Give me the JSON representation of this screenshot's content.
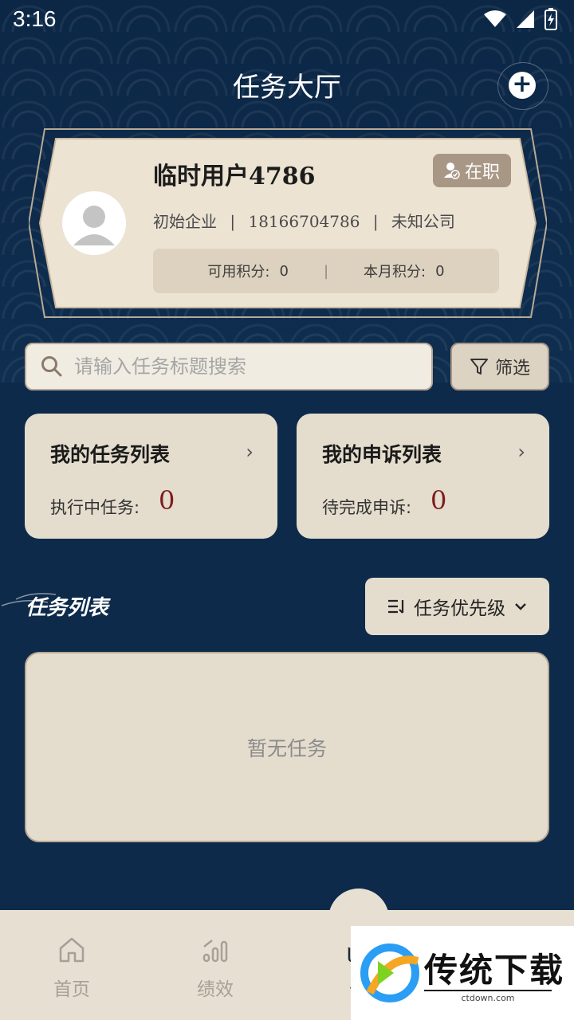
{
  "status_bar": {
    "time": "3:16"
  },
  "header": {
    "title": "任务大厅"
  },
  "profile": {
    "name": "临时用户4786",
    "status_badge": "在职",
    "company_type": "初始企业",
    "phone": "18166704786",
    "company": "未知公司",
    "separator": "|",
    "available_points_label": "可用积分:",
    "available_points": "0",
    "monthly_points_label": "本月积分:",
    "monthly_points": "0"
  },
  "search": {
    "placeholder": "请输入任务标题搜索"
  },
  "filter": {
    "label": "筛选"
  },
  "quick_cards": [
    {
      "title": "我的任务列表",
      "label": "执行中任务:",
      "count": "0"
    },
    {
      "title": "我的申诉列表",
      "label": "待完成申诉:",
      "count": "0"
    }
  ],
  "task_section": {
    "title": "任务列表",
    "sort_label": "任务优先级",
    "empty_text": "暂无任务"
  },
  "tabbar": {
    "items": [
      {
        "label": "首页",
        "icon": "home-icon"
      },
      {
        "label": "绩效",
        "icon": "chart-icon"
      },
      {
        "label": "任",
        "icon": "task-icon"
      }
    ]
  },
  "watermark": {
    "title": "传统下载",
    "url": "ctdown.com"
  },
  "colors": {
    "background": "#0d2a4a",
    "card": "#e4dccd",
    "accent_count": "#7d1d1d",
    "badge": "#a99786"
  }
}
